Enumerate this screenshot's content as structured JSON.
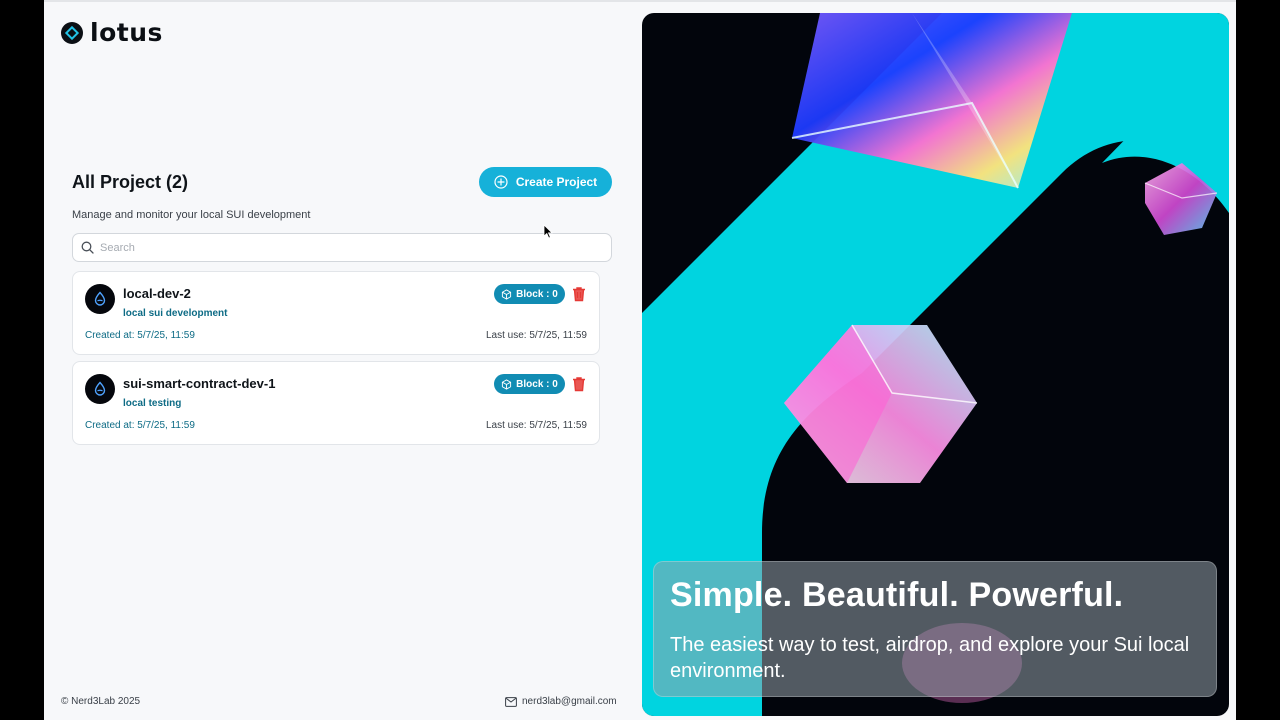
{
  "brand": {
    "name": "lotus"
  },
  "header": {
    "title": "All Project (2)",
    "subtitle": "Manage and monitor your local SUI development",
    "create_label": "Create Project"
  },
  "search": {
    "placeholder": "Search",
    "value": ""
  },
  "projects": [
    {
      "name": "local-dev-2",
      "description": "local sui development",
      "block": "Block : 0",
      "created": "Created at: 5/7/25, 11:59",
      "last_use": "Last use: 5/7/25, 11:59"
    },
    {
      "name": "sui-smart-contract-dev-1",
      "description": "local testing",
      "block": "Block : 0",
      "created": "Created at: 5/7/25, 11:59",
      "last_use": "Last use: 5/7/25, 11:59"
    }
  ],
  "footer": {
    "copyright": "© Nerd3Lab 2025",
    "email": "nerd3lab@gmail.com"
  },
  "hero": {
    "title": "Simple. Beautiful. Powerful.",
    "subtitle": "The easiest way to test, airdrop, and explore your Sui local environment."
  },
  "colors": {
    "accent": "#16b1d9",
    "badge": "#118cb3",
    "link_text": "#0d6b85",
    "delete": "#e53935",
    "hero_cyan": "#00d4e0",
    "hero_dark": "#02050c"
  },
  "icons": [
    "lotus-logo-icon",
    "plus-circle-icon",
    "search-icon",
    "sui-drop-icon",
    "cube-icon",
    "trash-icon",
    "mail-icon"
  ]
}
